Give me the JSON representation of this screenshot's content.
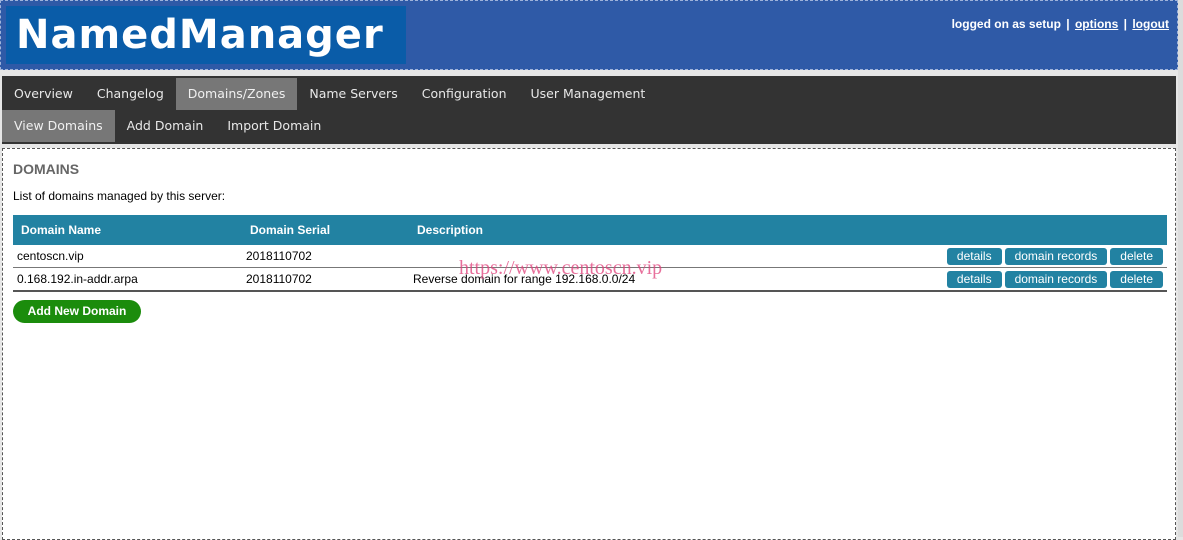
{
  "header": {
    "logo": "NamedManager",
    "logged_on_text": "logged on as setup",
    "separator": "|",
    "options_link": "options",
    "logout_link": "logout"
  },
  "nav": {
    "main": [
      "Overview",
      "Changelog",
      "Domains/Zones",
      "Name Servers",
      "Configuration",
      "User Management"
    ],
    "sub": [
      "View Domains",
      "Add Domain",
      "Import Domain"
    ]
  },
  "content": {
    "title": "DOMAINS",
    "intro": "List of domains managed by this server:",
    "table": {
      "headers": [
        "Domain Name",
        "Domain Serial",
        "Description"
      ],
      "rows": [
        {
          "name": "centoscn.vip",
          "serial": "2018110702",
          "description": ""
        },
        {
          "name": "0.168.192.in-addr.arpa",
          "serial": "2018110702",
          "description": "Reverse domain for range 192.168.0.0/24"
        }
      ],
      "actions": {
        "details": "details",
        "records": "domain records",
        "delete": "delete"
      }
    },
    "add_button": "Add New Domain",
    "watermark": "https://www.centoscn.vip"
  },
  "colors": {
    "header_bg": "#2f5aa7",
    "logo_bg": "#0a5ca8",
    "nav_bg": "#333333",
    "nav_active": "#777777",
    "table_header": "#2282a2",
    "add_button": "#1b8c0c"
  }
}
